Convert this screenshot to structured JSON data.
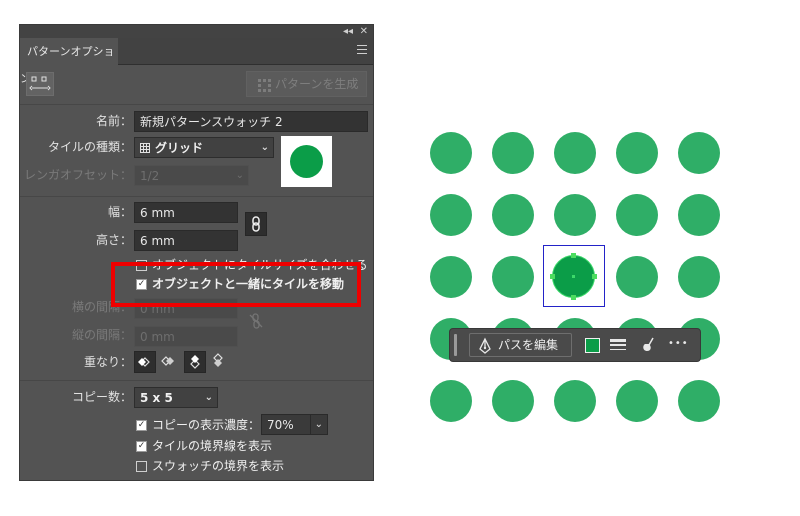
{
  "panel": {
    "collapse_glyph": "◂◂",
    "close_glyph": "✕",
    "tab_label": "パターンオプション",
    "generate_button": "パターンを生成",
    "name_label": "名前：",
    "name_value": "新規パターンスウォッチ 2",
    "tile_type_label": "タイルの種類：",
    "tile_type_value": "グリッド",
    "tile_type_icon": "grid-icon",
    "brick_offset_label": "レンガオフセット：",
    "brick_offset_value": "1/2",
    "width_label": "幅：",
    "width_value": "6 mm",
    "height_label": "高さ：",
    "height_value": "6 mm",
    "resize_tile_label": "オブジェクトにタイルサイズを合わせる",
    "move_tile_label": "オブジェクトと一緒にタイルを移動",
    "h_spacing_label": "横の間隔：",
    "h_spacing_value": "0 mm",
    "v_spacing_label": "縦の間隔：",
    "v_spacing_value": "0 mm",
    "overlap_label": "重なり：",
    "copies_label": "コピー数：",
    "copies_value": "5 x 5",
    "dim_copies_label": "コピーの表示濃度：",
    "dim_copies_value": "70%",
    "show_tile_edge_label": "タイルの境界線を表示",
    "show_swatch_bounds_label": "スウォッチの境界を表示",
    "checks": {
      "resize_tile": false,
      "move_tile": true,
      "dim_copies": true,
      "show_tile_edge": true,
      "show_swatch_bounds": false
    }
  },
  "canvas": {
    "dot_color": "#2fae67",
    "selected_dot_color": "#0b9d48",
    "context_bar": {
      "edit_path_label": "パスを編集",
      "more_glyph": "•••",
      "fill_swatch_color": "#0b9d48"
    }
  }
}
